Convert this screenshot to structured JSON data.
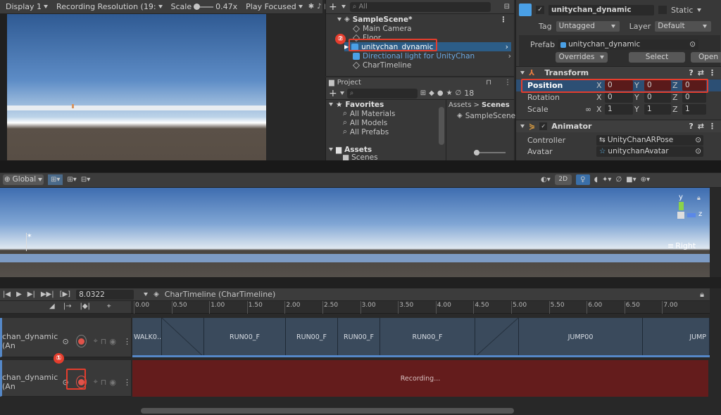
{
  "game_toolbar": {
    "display": "Display 1",
    "resolution": "Recording Resolution (19:",
    "scale_label": "Scale",
    "scale_value": "0.47x",
    "play_mode": "Play Focused"
  },
  "hierarchy": {
    "search_placeholder": "All",
    "scene_name": "SampleScene*",
    "items": [
      "Main Camera",
      "Floor",
      "unitychan_dynamic",
      "Directional light for UnityChan",
      "CharTimeline"
    ]
  },
  "project": {
    "tab_label": "Project",
    "badge_count": "18",
    "favorites_label": "Favorites",
    "favorites": [
      "All Materials",
      "All Models",
      "All Prefabs"
    ],
    "assets_label": "Assets",
    "assets_child": "Scenes",
    "breadcrumb_root": "Assets",
    "breadcrumb_sep": ">",
    "breadcrumb_current": "Scenes",
    "scene_file": "SampleScene"
  },
  "inspector": {
    "object_name": "unitychan_dynamic",
    "static_label": "Static",
    "tag_label": "Tag",
    "tag_value": "Untagged",
    "layer_label": "Layer",
    "layer_value": "Default",
    "prefab_label": "Prefab",
    "prefab_value": "unitychan_dynamic",
    "overrides_label": "Overrides",
    "select_label": "Select",
    "open_label": "Open",
    "transform_label": "Transform",
    "position_label": "Position",
    "rotation_label": "Rotation",
    "scale_label": "Scale",
    "axis_x": "X",
    "axis_y": "Y",
    "axis_z": "Z",
    "position": {
      "x": "0",
      "y": "0",
      "z": "0"
    },
    "rotation": {
      "x": "0",
      "y": "0",
      "z": "0"
    },
    "scale": {
      "x": "1",
      "y": "1",
      "z": "1"
    },
    "animator_label": "Animator",
    "controller_label": "Controller",
    "controller_value": "UnityChanARPose",
    "avatar_label": "Avatar",
    "avatar_value": "unitychanAvatar"
  },
  "scene_toolbar": {
    "pivot_mode": "Global",
    "mode_2d": "2D"
  },
  "scene_view": {
    "orientation_label": "Right",
    "gizmo_y": "y",
    "gizmo_z": "z"
  },
  "timeline": {
    "frame_value": "8.0322",
    "asset_label": "CharTimeline (CharTimeline)",
    "ruler_ticks": [
      "0.00",
      "0.50",
      "1.00",
      "1.50",
      "2.00",
      "2.50",
      "3.00",
      "3.50",
      "4.00",
      "4.50",
      "5.00",
      "5.50",
      "6.00",
      "6.50",
      "7.00"
    ],
    "track1_label": "chan_dynamic (An",
    "track2_label": "chan_dynamic (An",
    "clips": [
      "WALK0..",
      "RUN00_F",
      "RUN00_F",
      "RUN00_F",
      "RUN00_F",
      "JUMP00",
      "JUMP"
    ],
    "recording_text": "Recording..."
  },
  "annotations": {
    "marker1": "①",
    "marker2": "②"
  },
  "colors": {
    "accent_red": "#e53d2d",
    "recording_bg": "#641c1c",
    "clip_bg": "#3a4a5c",
    "selection_blue": "#4aa0e6"
  }
}
